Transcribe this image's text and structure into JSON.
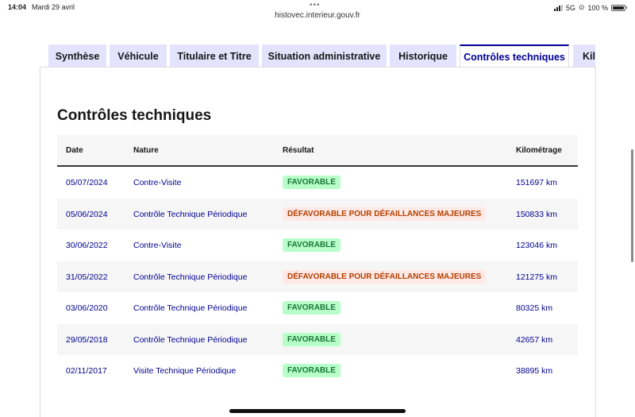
{
  "statusbar": {
    "time": "14:04",
    "date": "Mardi 29 avril",
    "network": "5G",
    "battery": "100 %"
  },
  "url": "histovec.interieur.gouv.fr",
  "tabs": [
    {
      "label": "Synthèse",
      "active": false
    },
    {
      "label": "Véhicule",
      "active": false
    },
    {
      "label": "Titulaire et Titre",
      "active": false
    },
    {
      "label": "Situation administrative",
      "active": false
    },
    {
      "label": "Historique",
      "active": false
    },
    {
      "label": "Contrôles techniques",
      "active": true
    },
    {
      "label": "Kilométrage",
      "active": false
    }
  ],
  "section_title": "Contrôles techniques",
  "table": {
    "headers": {
      "date": "Date",
      "nature": "Nature",
      "resultat": "Résultat",
      "km": "Kilométrage"
    },
    "rows": [
      {
        "date": "05/07/2024",
        "nature": "Contre-Visite",
        "resultat": "FAVORABLE",
        "status": "ok",
        "km": "151697 km"
      },
      {
        "date": "05/06/2024",
        "nature": "Contrôle Technique Périodique",
        "resultat": "DÉFAVORABLE POUR DÉFAILLANCES MAJEURES",
        "status": "ko",
        "km": "150833 km"
      },
      {
        "date": "30/06/2022",
        "nature": "Contre-Visite",
        "resultat": "FAVORABLE",
        "status": "ok",
        "km": "123046 km"
      },
      {
        "date": "31/05/2022",
        "nature": "Contrôle Technique Périodique",
        "resultat": "DÉFAVORABLE POUR DÉFAILLANCES MAJEURES",
        "status": "ko",
        "km": "121275 km"
      },
      {
        "date": "03/06/2020",
        "nature": "Contrôle Technique Périodique",
        "resultat": "FAVORABLE",
        "status": "ok",
        "km": "80325 km"
      },
      {
        "date": "29/05/2018",
        "nature": "Contrôle Technique Périodique",
        "resultat": "FAVORABLE",
        "status": "ok",
        "km": "42657 km"
      },
      {
        "date": "02/11/2017",
        "nature": "Visite Technique Périodique",
        "resultat": "FAVORABLE",
        "status": "ok",
        "km": "38895 km"
      }
    ]
  },
  "colors": {
    "accent": "#000091",
    "tab_bg": "#e3e3fd",
    "ok_bg": "#b8fec9",
    "ok_text": "#18753c",
    "ko_bg": "#ffe9e6",
    "ko_text": "#b34000"
  }
}
